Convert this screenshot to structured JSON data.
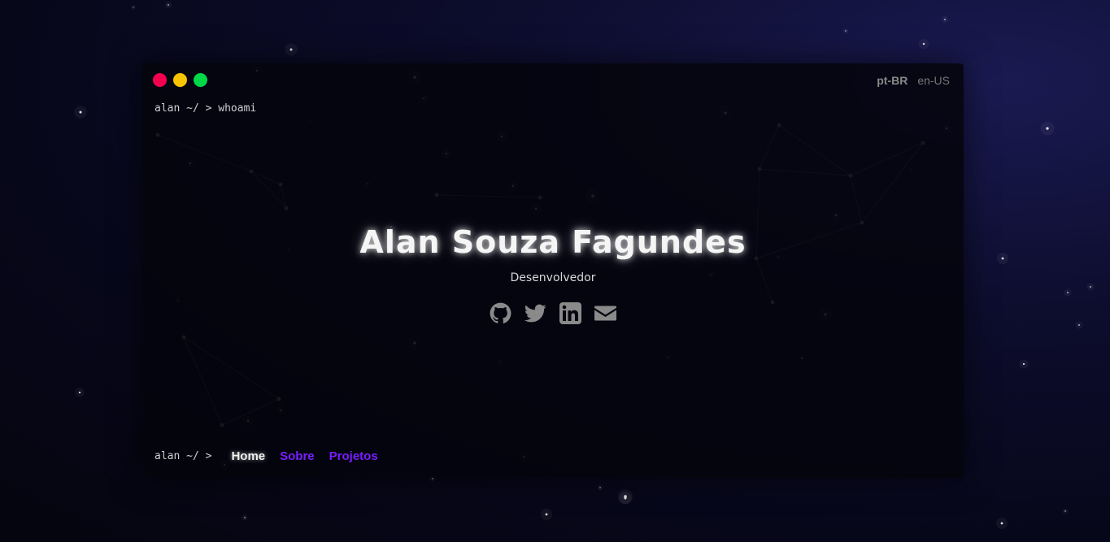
{
  "window": {
    "controls": [
      "close",
      "minimize",
      "maximize"
    ],
    "colors": {
      "close": "#f4004f",
      "minimize": "#f8c400",
      "maximize": "#00d84a"
    }
  },
  "language": {
    "options": [
      "pt-BR",
      "en-US"
    ],
    "selected": "pt-BR"
  },
  "terminal": {
    "top_prompt": "alan ~/ > whoami",
    "bottom_prompt": "alan ~/ >"
  },
  "hero": {
    "name": "Alan Souza Fagundes",
    "role": "Desenvolvedor"
  },
  "socials": [
    {
      "icon": "github-icon"
    },
    {
      "icon": "twitter-icon"
    },
    {
      "icon": "linkedin-icon"
    },
    {
      "icon": "email-icon"
    }
  ],
  "nav": {
    "home": "Home",
    "about": "Sobre",
    "projects": "Projetos"
  },
  "colors": {
    "accent": "#7a1dff",
    "background": "#05050f"
  }
}
